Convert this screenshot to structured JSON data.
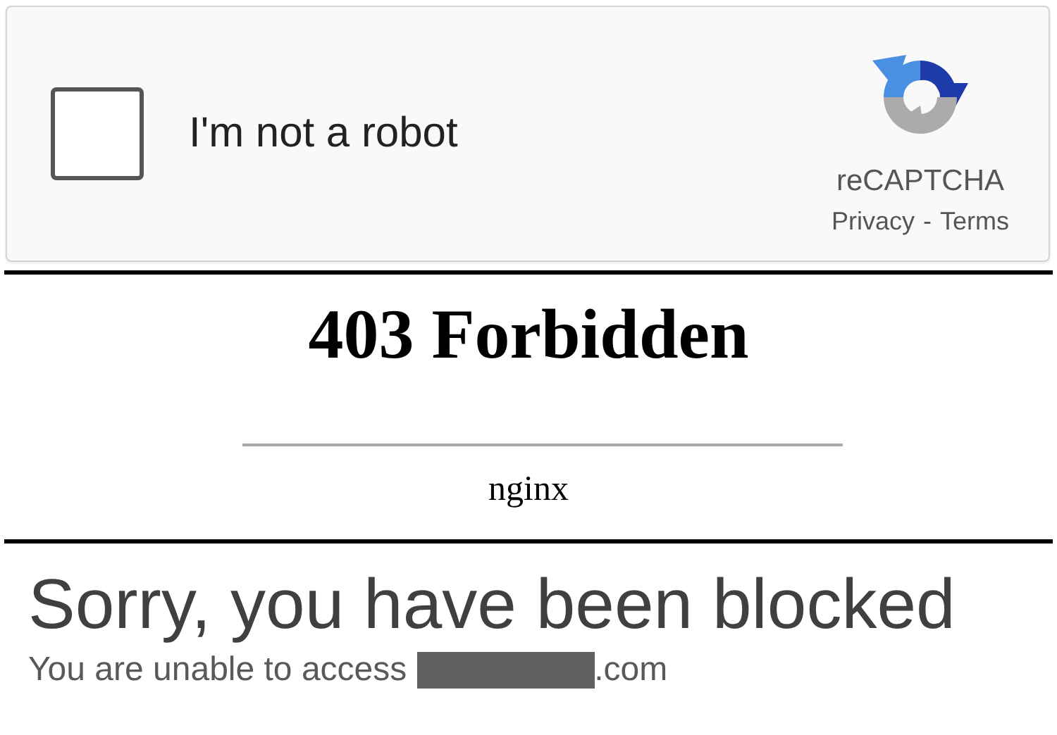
{
  "captcha": {
    "checked": false,
    "label": "I'm not a robot",
    "brand": "reCAPTCHA",
    "privacy_link": "Privacy",
    "separator": "-",
    "terms_link": "Terms"
  },
  "error_page": {
    "title": "403 Forbidden",
    "server": "nginx"
  },
  "block_page": {
    "heading": "Sorry, you have been blocked",
    "message": "You are unable to access",
    "domain_suffix": ".com"
  }
}
